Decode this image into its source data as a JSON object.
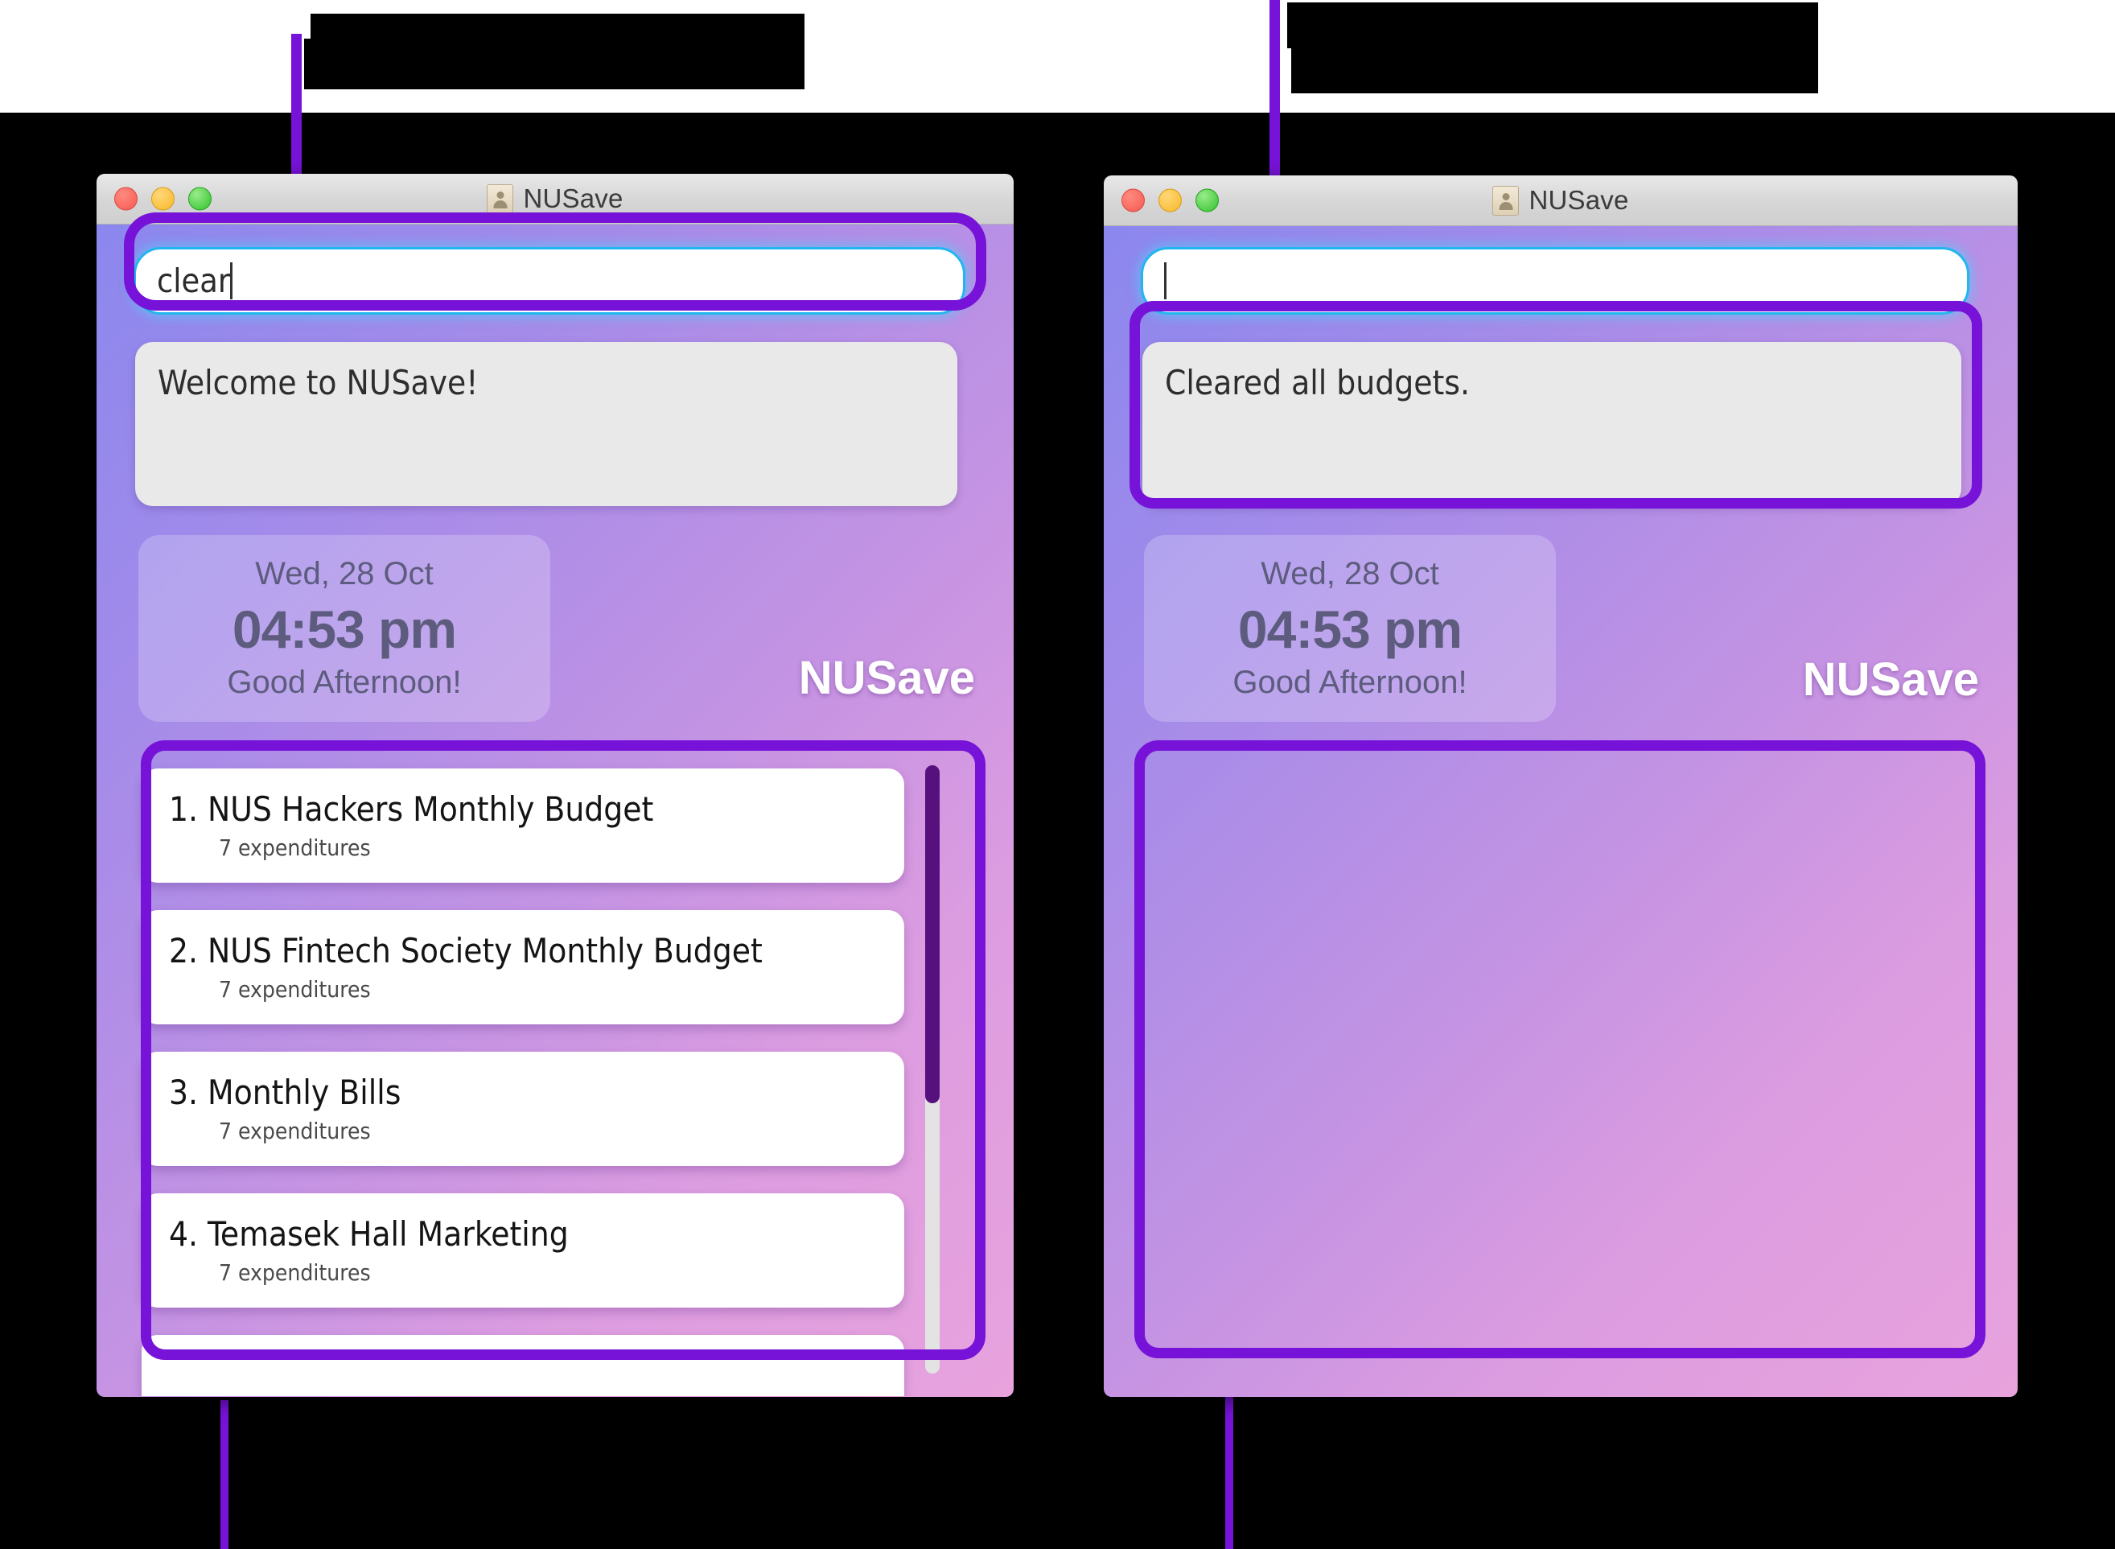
{
  "app": {
    "name": "NUSave",
    "window_icon": "contact-card-icon"
  },
  "accent": {
    "highlight_purple": "#7712d8",
    "input_focus_blue": "#22b6ee",
    "scroll_thumb_purple": "#56117e"
  },
  "left_window": {
    "title": "NUSave",
    "traffic_lights": [
      "close-red",
      "minimize-yellow",
      "zoom-green"
    ],
    "command_input": {
      "value": "clear",
      "placeholder": ""
    },
    "result_box": {
      "text": "Welcome to NUSave!"
    },
    "clock": {
      "date": "Wed, 28 Oct",
      "time": "04:53 pm",
      "greeting": "Good Afternoon!"
    },
    "brand": "NUSave",
    "budget_list": {
      "items": [
        {
          "index": "1.",
          "name": "NUS Hackers Monthly Budget",
          "meta": "7 expenditures"
        },
        {
          "index": "2.",
          "name": "NUS Fintech Society Monthly Budget",
          "meta": "7 expenditures"
        },
        {
          "index": "3.",
          "name": "Monthly Bills",
          "meta": "7 expenditures"
        },
        {
          "index": "4.",
          "name": "Temasek Hall Marketing",
          "meta": "7 expenditures"
        }
      ]
    }
  },
  "right_window": {
    "title": "NUSave",
    "traffic_lights": [
      "close-red",
      "minimize-yellow",
      "zoom-green"
    ],
    "command_input": {
      "value": "",
      "placeholder": ""
    },
    "result_box": {
      "text": "Cleared all budgets."
    },
    "clock": {
      "date": "Wed, 28 Oct",
      "time": "04:53 pm",
      "greeting": "Good Afternoon!"
    },
    "brand": "NUSave",
    "budget_list": {
      "items": []
    }
  },
  "annotations": {
    "top_left": {
      "text": "",
      "redacted": true
    },
    "top_right": {
      "text": "",
      "redacted": true
    },
    "bottom_left": {
      "text": "",
      "redacted": true
    },
    "bottom_right": {
      "text": "",
      "redacted": true
    }
  }
}
